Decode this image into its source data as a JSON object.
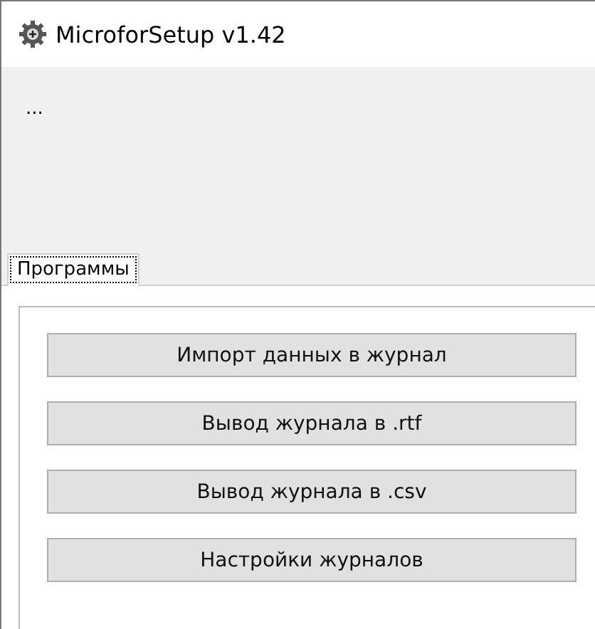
{
  "window": {
    "title": "MicroforSetup v1.42"
  },
  "status_text": "...",
  "tabs": [
    {
      "label": "Программы",
      "selected": true
    }
  ],
  "buttons": [
    "Импорт данных в журнал",
    "Вывод журнала в .rtf",
    "Вывод журнала в .csv",
    "Настройки журналов"
  ]
}
